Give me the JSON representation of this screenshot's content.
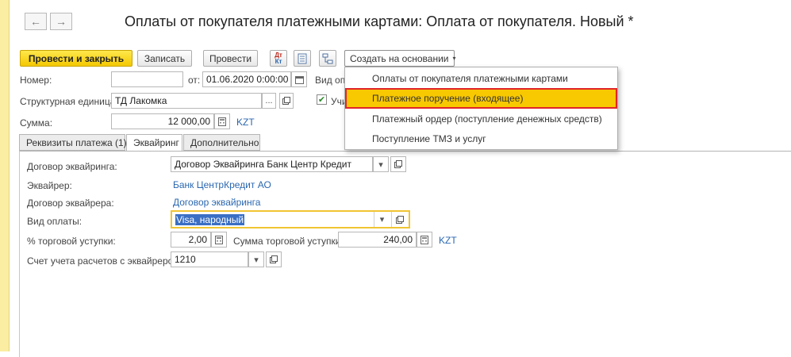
{
  "window": {
    "title": "Оплаты от покупателя платежными картами: Оплата от покупателя. Новый *"
  },
  "nav": {
    "back_glyph": "←",
    "forward_glyph": "→"
  },
  "toolbar": {
    "post_and_close": "Провести и закрыть",
    "save": "Записать",
    "post": "Провести",
    "dtkt_icon_text": "Дт Кт",
    "create_based_on": "Создать на основании"
  },
  "form": {
    "number_label": "Номер:",
    "number_value": "",
    "date_prefix": "от:",
    "date_value": "01.06.2020  0:00:00",
    "op_type_label": "Вид опе",
    "unit_label": "Структурная единица:",
    "unit_value": "ТД Лакомка",
    "checkbox_label": "Учи",
    "checkbox_checked": true,
    "sum_label": "Сумма:",
    "sum_value": "12 000,00",
    "currency": "KZT"
  },
  "tabs": [
    "Реквизиты платежа (1)",
    "Эквайринг",
    "Дополнительно"
  ],
  "acquiring": {
    "contract_label": "Договор эквайринга:",
    "contract_value": "Договор Эквайринга Банк Центр Кредит",
    "acquirer_label": "Эквайрер:",
    "acquirer_value": "Банк ЦентрКредит АО",
    "acquirer_contract_label": "Договор эквайрера:",
    "acquirer_contract_value": "Договор эквайринга",
    "payment_type_label": "Вид оплаты:",
    "payment_type_value": "Visa, народный",
    "discount_pct_label": "% торговой уступки:",
    "discount_pct_value": "2,00",
    "discount_sum_label": "Сумма торговой уступки:",
    "discount_sum_value": "240,00",
    "currency": "KZT",
    "account_label": "Счет учета расчетов с эквайрером:",
    "account_value": "1210"
  },
  "dropdown_menu": {
    "items": [
      "Оплаты от покупателя платежными картами",
      "Платежное поручение (входящее)",
      "Платежный ордер (поступление денежных средств)",
      "Поступление ТМЗ и услуг"
    ],
    "highlighted_index": 1
  },
  "colors": {
    "accent_yellow": "#f4c800",
    "link_blue": "#2b67b0",
    "highlight_red": "#e0252a"
  }
}
